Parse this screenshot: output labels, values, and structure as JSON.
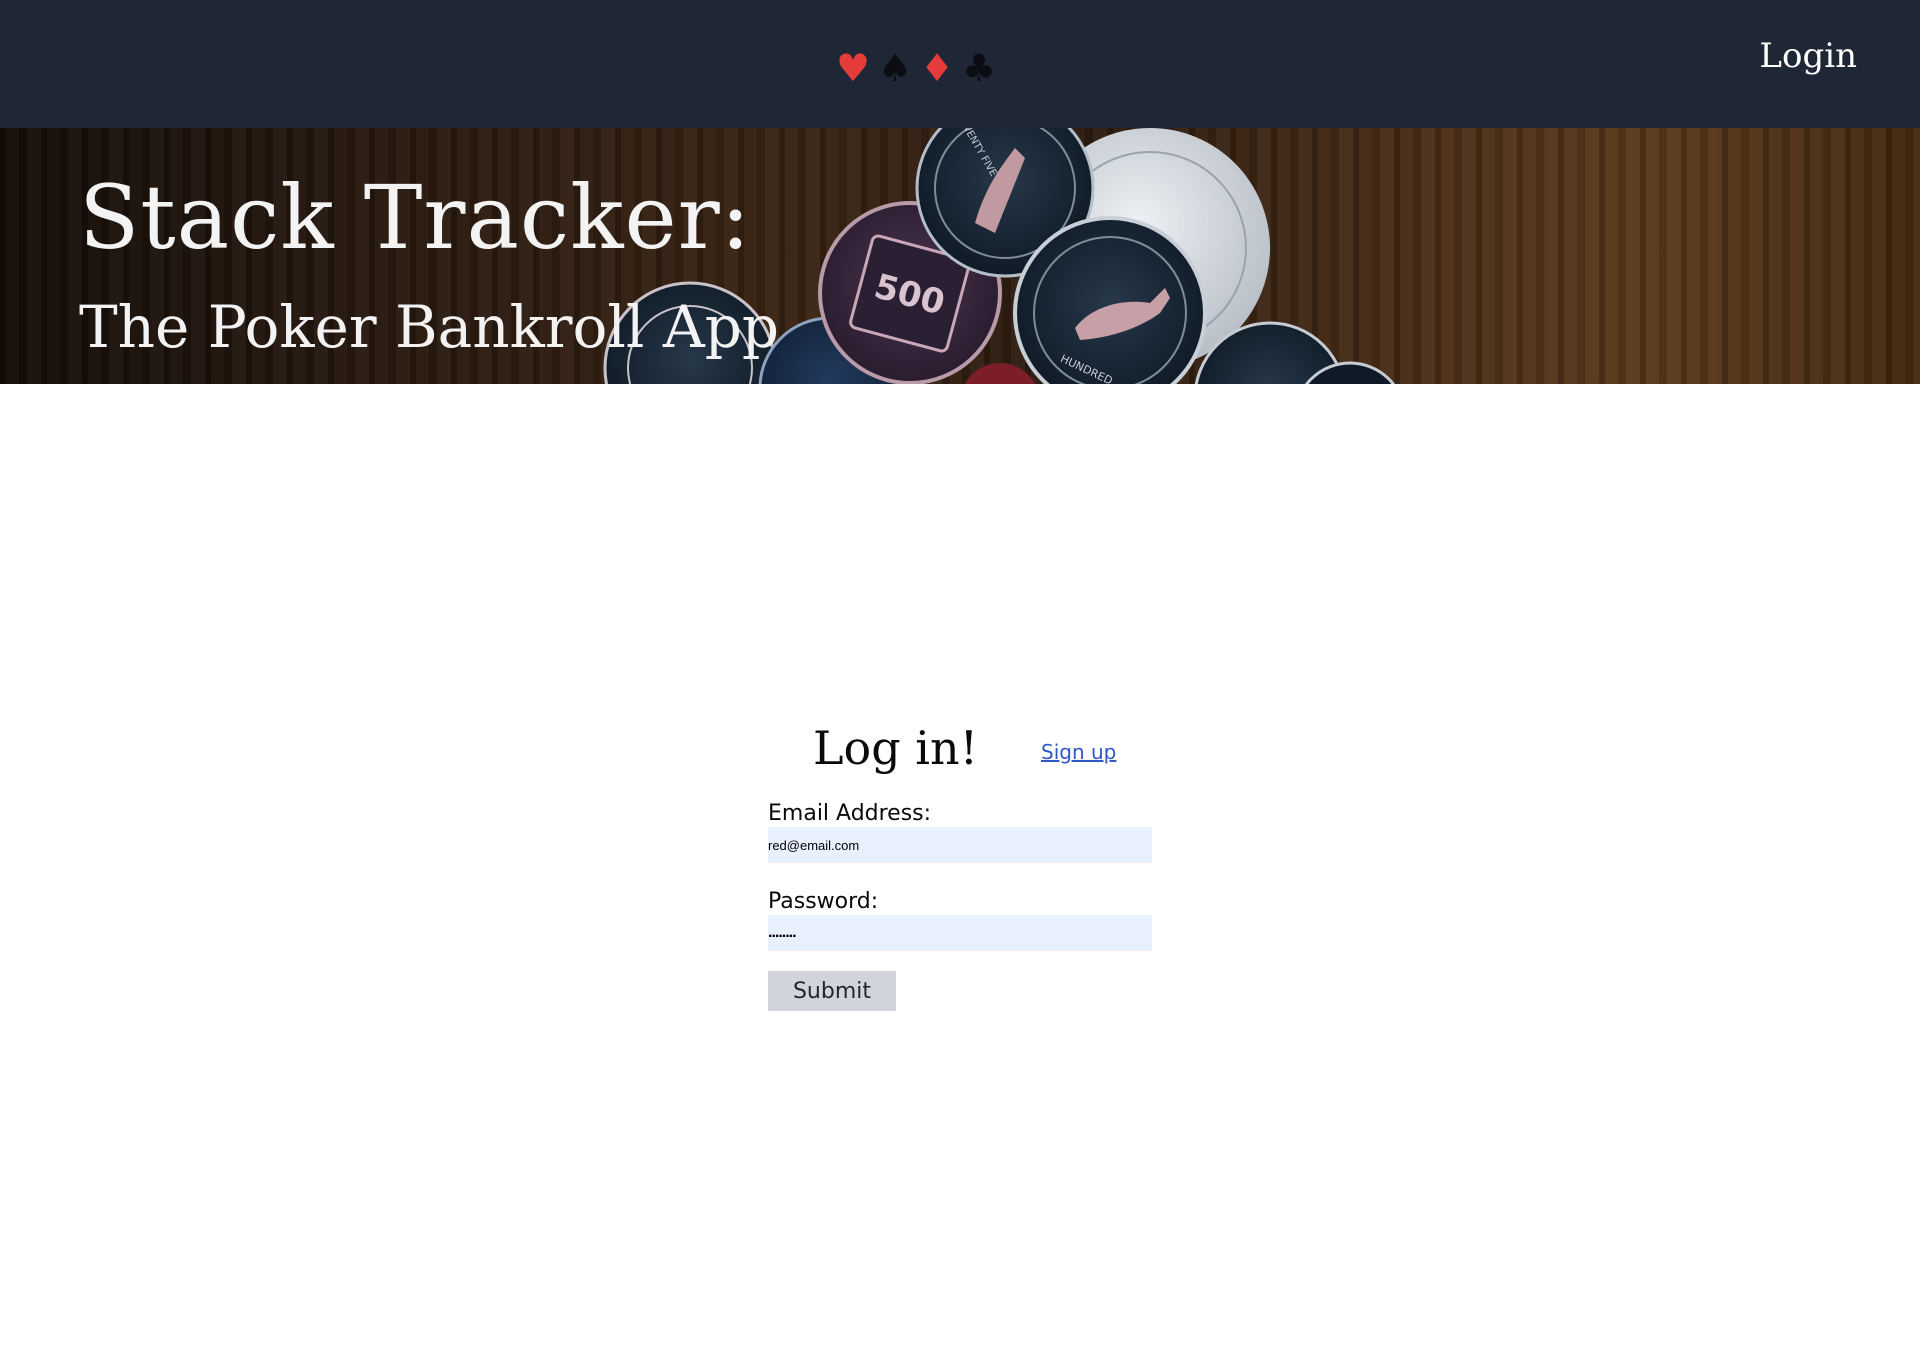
{
  "navbar": {
    "suits": [
      {
        "glyph": "♥",
        "name": "heart",
        "color": "#e53b3b"
      },
      {
        "glyph": "♠",
        "name": "spade",
        "color": "#0b0d12"
      },
      {
        "glyph": "♦",
        "name": "diamond",
        "color": "#e53b3b"
      },
      {
        "glyph": "♣",
        "name": "club",
        "color": "#0b0d12"
      }
    ],
    "login_label": "Login",
    "background": "#1f2737"
  },
  "hero": {
    "title": "Stack Tracker:",
    "subtitle": "The Poker Bankroll App",
    "chip_500_label": "500",
    "chip_twenty_five_label": "TWENTY FIVE",
    "chip_hundred_label": "HUNDRED"
  },
  "login": {
    "heading": "Log in!",
    "signup_label": "Sign up",
    "email_label": "Email Address:",
    "email_value": "red@email.com",
    "password_label": "Password:",
    "password_value": "........",
    "submit_label": "Submit"
  }
}
